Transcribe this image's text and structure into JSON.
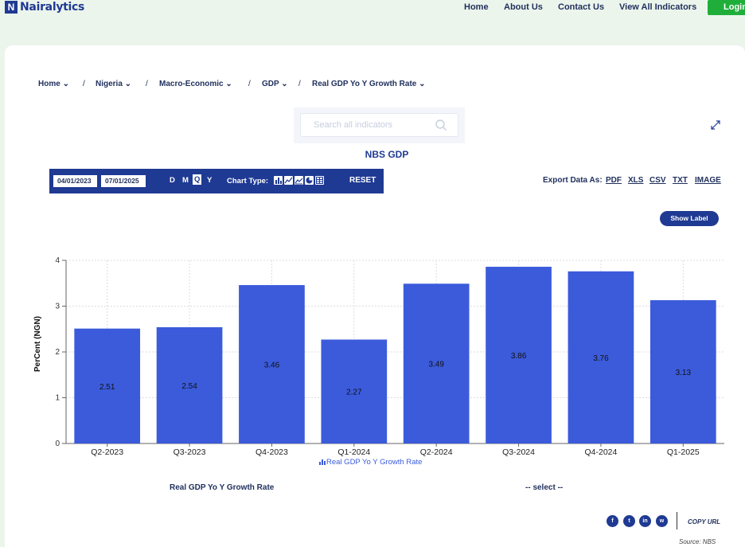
{
  "header": {
    "logo_letter": "N",
    "logo_text": "Nairalytics",
    "nav": [
      "Home",
      "About Us",
      "Contact Us",
      "View All Indicators"
    ],
    "login_label": "Login"
  },
  "breadcrumb": [
    "Home",
    "Nigeria",
    "Macro-Economic",
    "GDP",
    "Real GDP Yo Y Growth Rate"
  ],
  "search": {
    "placeholder": "Search all indicators"
  },
  "chart_heading": "NBS GDP",
  "toolbar": {
    "start_date": "04/01/2023",
    "end_date": "07/01/2025",
    "frequencies": [
      "D",
      "M",
      "Q",
      "Y"
    ],
    "active_frequency": "Q",
    "chart_type_label": "Chart Type:",
    "reset_label": "RESET"
  },
  "export": {
    "label": "Export Data As:",
    "formats": [
      "PDF",
      "XLS",
      "CSV",
      "TXT",
      "IMAGE"
    ]
  },
  "show_label_button": "Show Label",
  "chart_data": {
    "type": "bar",
    "ylabel": "PerCent (NGN)",
    "xlabel": "",
    "categories": [
      "Q2-2023",
      "Q3-2023",
      "Q4-2023",
      "Q1-2024",
      "Q2-2024",
      "Q3-2024",
      "Q4-2024",
      "Q1-2025"
    ],
    "series": [
      {
        "name": "Real GDP Yo Y Growth Rate",
        "values": [
          2.51,
          2.54,
          3.46,
          2.27,
          3.49,
          3.86,
          3.76,
          3.13
        ]
      }
    ],
    "value_labels": [
      "2.51",
      "2.54",
      "3.46",
      "2.27",
      "3.49",
      "3.86",
      "3.76",
      "3.13"
    ],
    "ylim": [
      0,
      4
    ],
    "yticks": [
      0,
      1,
      2,
      3,
      4
    ],
    "grid": true,
    "legend": "bottom-center",
    "bar_color": "#3b5bdb",
    "legend_icon": "bar-chart-icon"
  },
  "footer": {
    "series_select": "Real GDP Yo Y Growth Rate",
    "compare_select": "-- select --",
    "social_icons": [
      "facebook-icon",
      "twitter-icon",
      "linkedin-icon",
      "whatsapp-icon"
    ],
    "copy_url": "COPY URL",
    "source": "Source: NBS"
  },
  "colors": {
    "brand": "#1f3a93",
    "login": "#1fae3a",
    "page_bg": "#ecf5ec",
    "bar": "#3b5bdb"
  }
}
